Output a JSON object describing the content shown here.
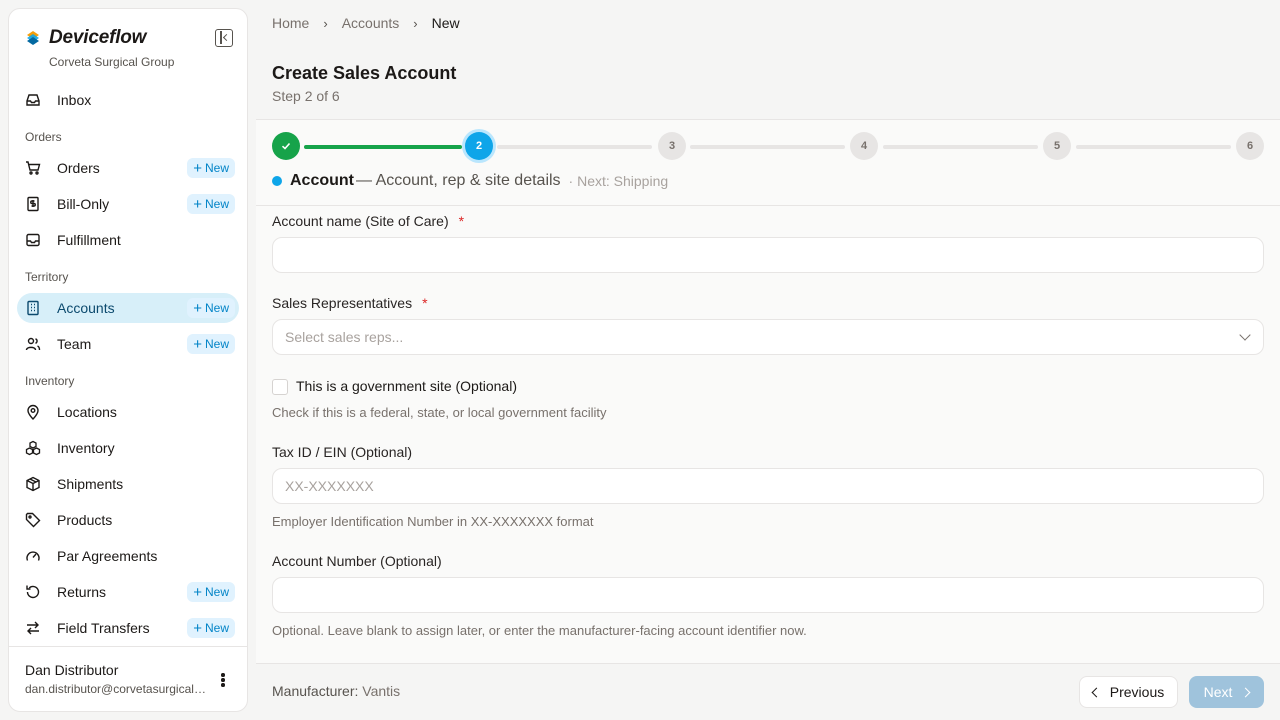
{
  "sidebar": {
    "brand": "Deviceflow",
    "org": "Corveta Surgical Group",
    "inbox": "Inbox",
    "sections": {
      "orders": "Orders",
      "territory": "Territory",
      "inventory": "Inventory"
    },
    "items": {
      "orders": "Orders",
      "bill_only": "Bill-Only",
      "fulfillment": "Fulfillment",
      "accounts": "Accounts",
      "team": "Team",
      "locations": "Locations",
      "inventory": "Inventory",
      "shipments": "Shipments",
      "products": "Products",
      "par_agreements": "Par Agreements",
      "returns": "Returns",
      "field_transfers": "Field Transfers"
    },
    "new_label": "New",
    "user": {
      "name": "Dan Distributor",
      "email": "dan.distributor@corvetasurgicalgroup.com"
    }
  },
  "breadcrumb": {
    "home": "Home",
    "accounts": "Accounts",
    "current": "New"
  },
  "page": {
    "title": "Create Sales Account",
    "subtitle": "Step 2 of 6"
  },
  "stepper": {
    "steps": [
      "2",
      "3",
      "4",
      "5",
      "6"
    ],
    "current_name": "Account",
    "current_desc": "— Account, rep & site details",
    "next": "· Next: Shipping"
  },
  "form": {
    "account_name_label": "Account name (Site of Care)",
    "required_mark": "*",
    "sales_reps_label": "Sales Representatives",
    "sales_reps_placeholder": "Select sales reps...",
    "gov_label": "This is a government site (Optional)",
    "gov_help": "Check if this is a federal, state, or local government facility",
    "tax_label": "Tax ID / EIN (Optional)",
    "tax_placeholder": "XX-XXXXXXX",
    "tax_help": "Employer Identification Number in XX-XXXXXXX format",
    "acct_num_label": "Account Number (Optional)",
    "acct_num_help": "Optional. Leave blank to assign later, or enter the manufacturer-facing account identifier now."
  },
  "footer": {
    "manufacturer_label": "Manufacturer:",
    "manufacturer_value": "Vantis",
    "previous": "Previous",
    "next": "Next"
  },
  "colors": {
    "accent": "#0ea5e9",
    "success": "#16a34a",
    "active_bg": "#d7eff9"
  }
}
